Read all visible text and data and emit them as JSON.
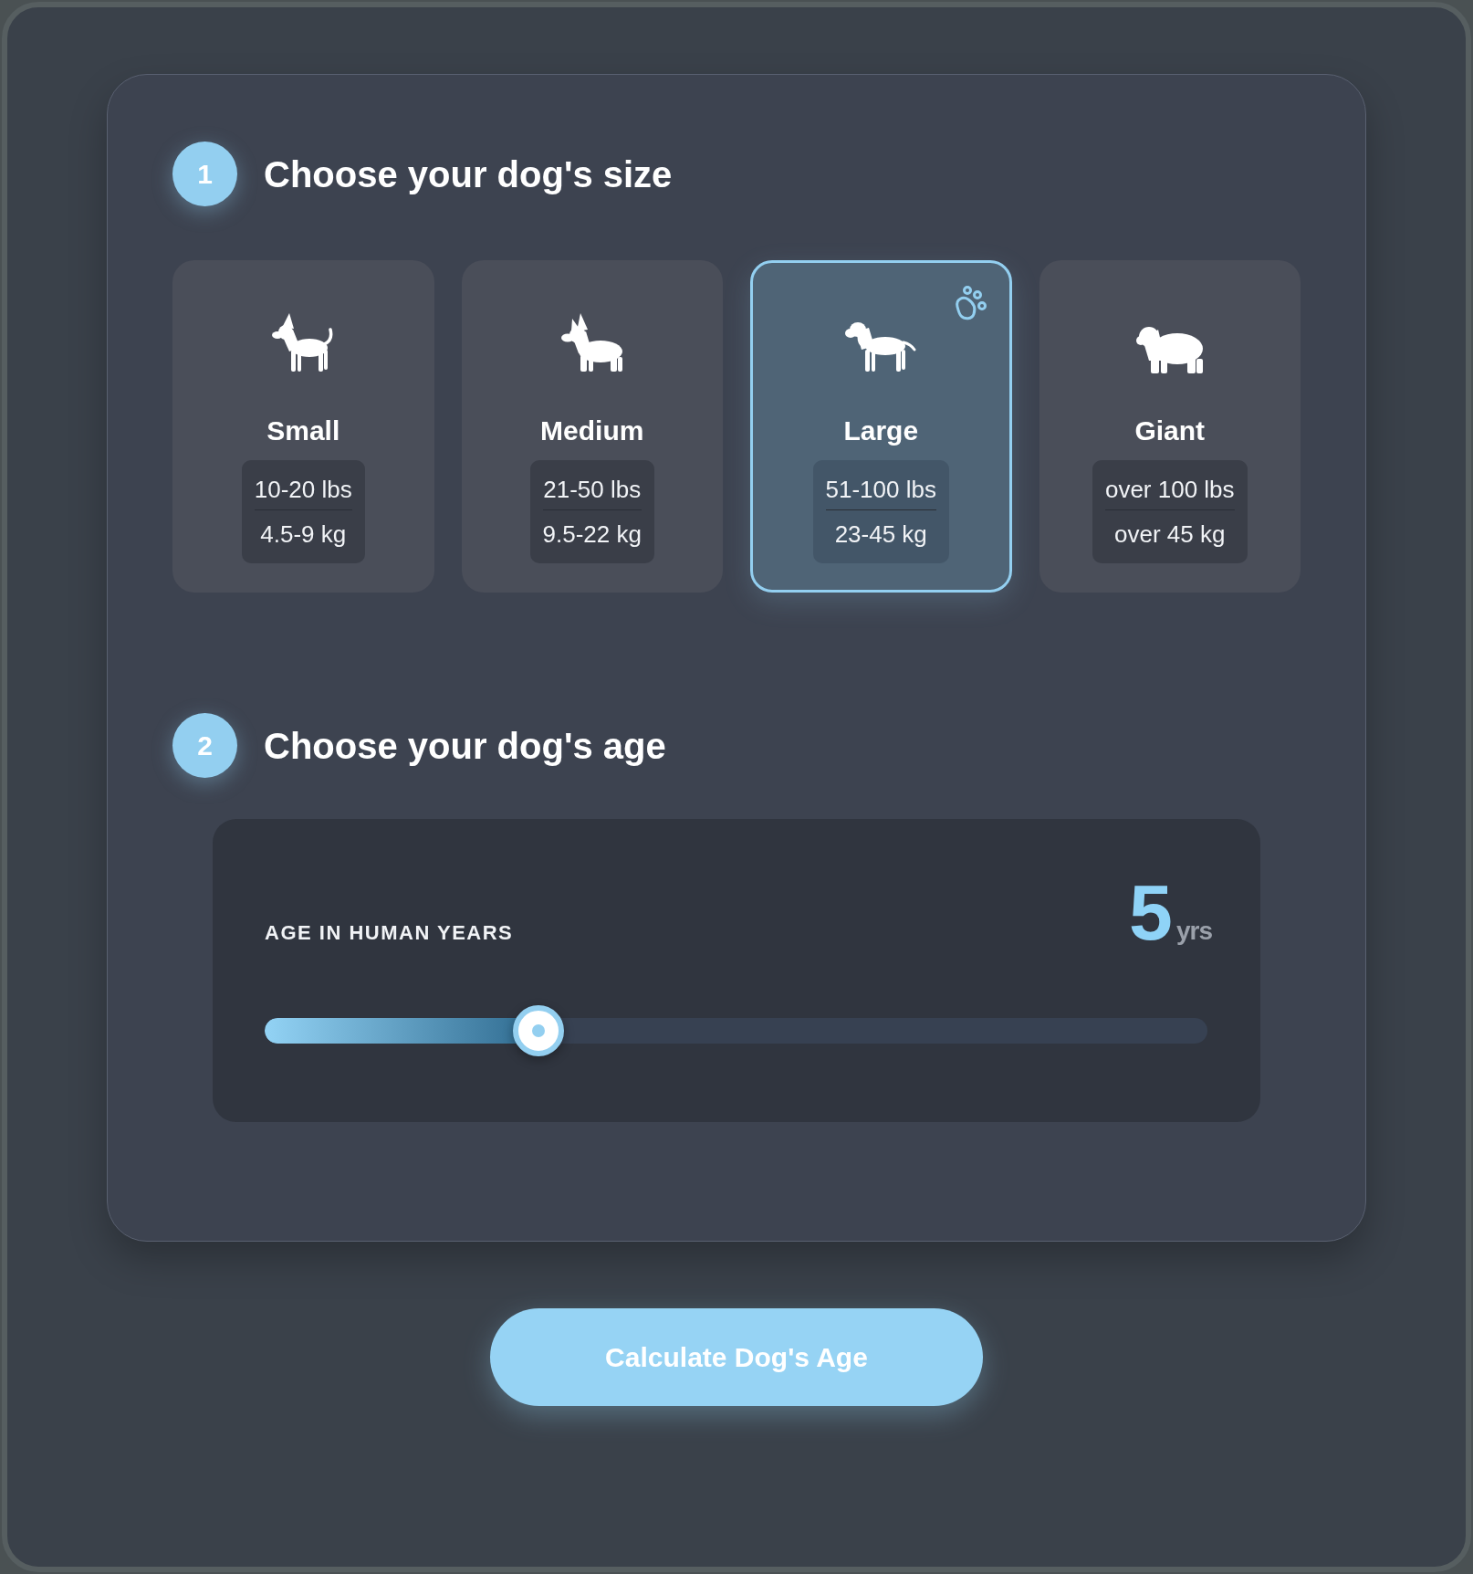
{
  "size_step": {
    "number": "1",
    "title": "Choose your dog's size",
    "options": [
      {
        "kind": "small",
        "name": "Small",
        "weight_lbs": "10-20 lbs",
        "weight_kg": "4.5-9 kg",
        "selected": false
      },
      {
        "kind": "medium",
        "name": "Medium",
        "weight_lbs": "21-50 lbs",
        "weight_kg": "9.5-22 kg",
        "selected": false
      },
      {
        "kind": "large",
        "name": "Large",
        "weight_lbs": "51-100 lbs",
        "weight_kg": "23-45 kg",
        "selected": true
      },
      {
        "kind": "giant",
        "name": "Giant",
        "weight_lbs": "over 100 lbs",
        "weight_kg": "over 45 kg",
        "selected": false
      }
    ]
  },
  "age_step": {
    "number": "2",
    "title": "Choose your dog's age",
    "slider": {
      "label": "AGE IN HUMAN YEARS",
      "value": "5",
      "unit": "yrs",
      "level": 0.29
    }
  },
  "calculate_button": {
    "label": "Calculate Dog's Age"
  }
}
